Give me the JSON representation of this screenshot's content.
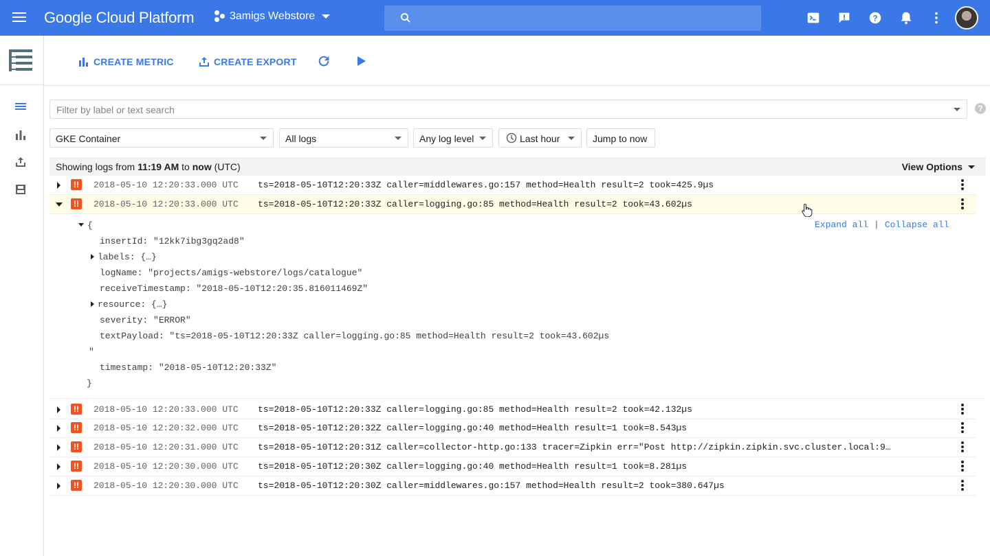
{
  "app": {
    "brand": "Google Cloud Platform",
    "project": "3amigs Webstore",
    "search_placeholder": ""
  },
  "toolbar": {
    "create_metric": "CREATE METRIC",
    "create_export": "CREATE EXPORT"
  },
  "filter": {
    "placeholder": "Filter by label or text search",
    "resource": "GKE Container",
    "logs": "All logs",
    "level": "Any log level",
    "time": "Last hour",
    "jump": "Jump to now",
    "help": "?"
  },
  "log_header": {
    "prefix": "Showing logs from ",
    "from": "11:19 AM",
    "mid": " to ",
    "to": "now",
    "suffix": " (UTC)",
    "view_options": "View Options"
  },
  "severity_glyph": "!!",
  "rows": [
    {
      "timestamp": "2018-05-10 12:20:33.000 UTC",
      "message": "ts=2018-05-10T12:20:33Z caller=middlewares.go:157 method=Health result=2 took=425.9µs"
    },
    {
      "timestamp": "2018-05-10 12:20:33.000 UTC",
      "message": "ts=2018-05-10T12:20:33Z caller=logging.go:85 method=Health result=2 took=43.602µs"
    },
    {
      "timestamp": "2018-05-10 12:20:33.000 UTC",
      "message": "ts=2018-05-10T12:20:33Z caller=logging.go:85 method=Health result=2 took=42.132µs"
    },
    {
      "timestamp": "2018-05-10 12:20:32.000 UTC",
      "message": "ts=2018-05-10T12:20:32Z caller=logging.go:40 method=Health result=1 took=8.543µs"
    },
    {
      "timestamp": "2018-05-10 12:20:31.000 UTC",
      "message": "ts=2018-05-10T12:20:31Z caller=collector-http.go:133 tracer=Zipkin err=\"Post http://zipkin.zipkin.svc.cluster.local:9…"
    },
    {
      "timestamp": "2018-05-10 12:20:30.000 UTC",
      "message": "ts=2018-05-10T12:20:30Z caller=logging.go:40 method=Health result=1 took=8.281µs"
    },
    {
      "timestamp": "2018-05-10 12:20:30.000 UTC",
      "message": "ts=2018-05-10T12:20:30Z caller=middlewares.go:157 method=Health result=2 took=380.647µs"
    }
  ],
  "detail": {
    "open_brace": "{",
    "insertId": "insertId: \"12kk7ibg3gq2ad8\"",
    "labels": "labels: {…}",
    "logName": "logName: \"projects/amigs-webstore/logs/catalogue\"",
    "receiveTimestamp": "receiveTimestamp: \"2018-05-10T12:20:35.816011469Z\"",
    "resource": "resource: {…}",
    "severity": "severity: \"ERROR\"",
    "textPayload": "textPayload: \"ts=2018-05-10T12:20:33Z caller=logging.go:85 method=Health result=2 took=43.602µs",
    "textPayload_end": "\"",
    "timestamp": "timestamp: \"2018-05-10T12:20:33Z\"",
    "close_brace": "}",
    "expand_all": "Expand all",
    "separator": "|",
    "collapse_all": "Collapse all"
  },
  "colors": {
    "header_blue": "#3b78e7",
    "error_orange": "#f4511e",
    "selected_row": "#fffde7"
  }
}
